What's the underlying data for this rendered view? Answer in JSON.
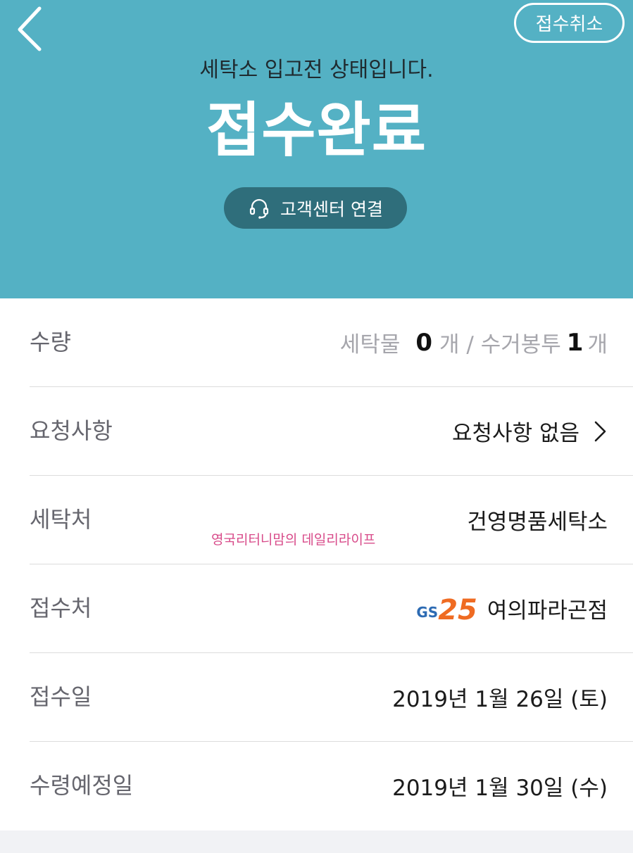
{
  "header": {
    "cancel_label": "접수취소",
    "subtitle": "세탁소 입고전 상태입니다.",
    "title": "접수완료",
    "cs_label": "고객센터 연결"
  },
  "rows": {
    "quantity": {
      "label": "수량",
      "laundry_label": "세탁물",
      "laundry_count": "0",
      "unit1": "개 / 수거봉투",
      "bag_count": "1",
      "unit2": "개"
    },
    "request": {
      "label": "요청사항",
      "value": "요청사항 없음"
    },
    "laundry_shop": {
      "label": "세탁처",
      "value": "건영명품세탁소",
      "watermark": "영국리터니맘의 데일리라이프"
    },
    "pickup_place": {
      "label": "접수처",
      "logo_gs": "GS",
      "logo_25": "25",
      "value": "여의파라곤점"
    },
    "received_date": {
      "label": "접수일",
      "value": "2019년 1월 26일 (토)"
    },
    "expected_date": {
      "label": "수령예정일",
      "value": "2019년 1월 30일 (수)"
    }
  },
  "colors": {
    "header_bg": "#54b1c4",
    "cs_button_bg": "#2f6e7b",
    "watermark": "#d84b8a"
  },
  "icons": {
    "back": "chevron-left-icon",
    "headset": "headset-icon",
    "chevron": "chevron-right-icon"
  }
}
